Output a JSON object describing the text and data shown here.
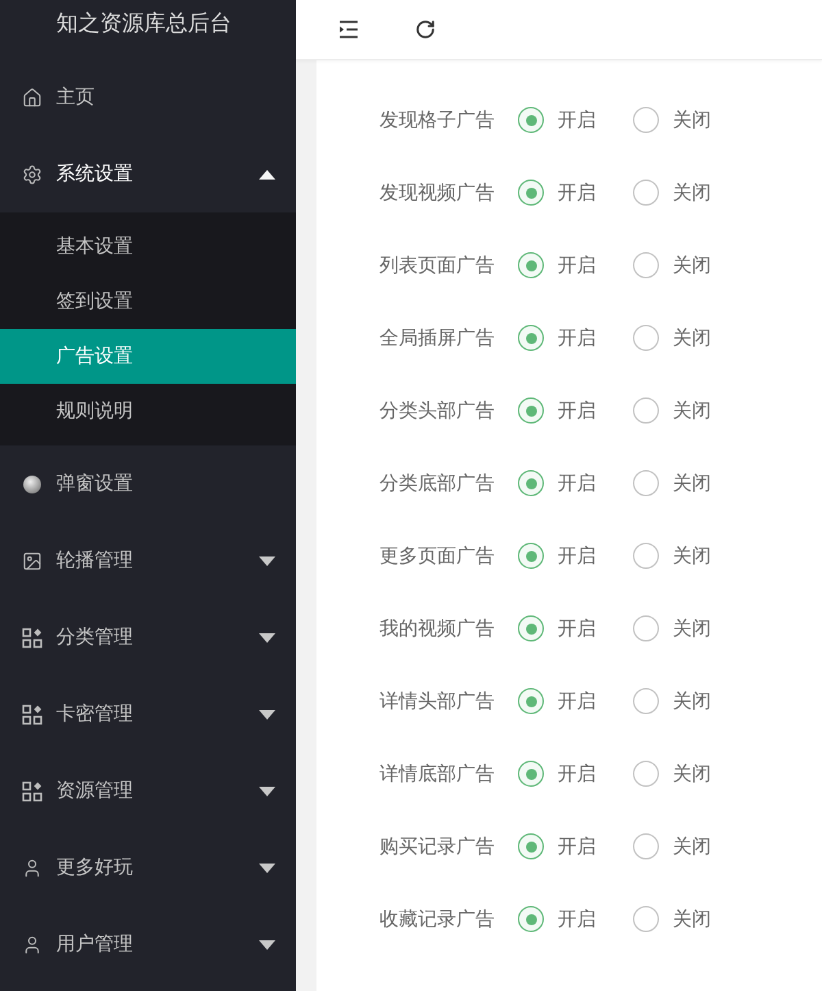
{
  "sidebar": {
    "title": "知之资源库总后台",
    "items": [
      {
        "label": "主页",
        "kind": "link"
      },
      {
        "label": "系统设置",
        "kind": "group",
        "expanded": true,
        "children": [
          {
            "label": "基本设置",
            "selected": false
          },
          {
            "label": "签到设置",
            "selected": false
          },
          {
            "label": "广告设置",
            "selected": true
          },
          {
            "label": "规则说明",
            "selected": false
          }
        ]
      },
      {
        "label": "弹窗设置",
        "kind": "link"
      },
      {
        "label": "轮播管理",
        "kind": "group",
        "expanded": false
      },
      {
        "label": "分类管理",
        "kind": "group",
        "expanded": false
      },
      {
        "label": "卡密管理",
        "kind": "group",
        "expanded": false
      },
      {
        "label": "资源管理",
        "kind": "group",
        "expanded": false
      },
      {
        "label": "更多好玩",
        "kind": "group",
        "expanded": false
      },
      {
        "label": "用户管理",
        "kind": "group",
        "expanded": false
      }
    ]
  },
  "settings": {
    "rows": [
      {
        "label": "发现格子广告",
        "options": [
          {
            "label": "开启",
            "selected": true
          },
          {
            "label": "关闭",
            "selected": false
          }
        ]
      },
      {
        "label": "发现视频广告",
        "options": [
          {
            "label": "开启",
            "selected": true
          },
          {
            "label": "关闭",
            "selected": false
          }
        ]
      },
      {
        "label": "列表页面广告",
        "options": [
          {
            "label": "开启",
            "selected": true
          },
          {
            "label": "关闭",
            "selected": false
          }
        ]
      },
      {
        "label": "全局插屏广告",
        "options": [
          {
            "label": "开启",
            "selected": true
          },
          {
            "label": "关闭",
            "selected": false
          }
        ]
      },
      {
        "label": "分类头部广告",
        "options": [
          {
            "label": "开启",
            "selected": true
          },
          {
            "label": "关闭",
            "selected": false
          }
        ]
      },
      {
        "label": "分类底部广告",
        "options": [
          {
            "label": "开启",
            "selected": true
          },
          {
            "label": "关闭",
            "selected": false
          }
        ]
      },
      {
        "label": "更多页面广告",
        "options": [
          {
            "label": "开启",
            "selected": true
          },
          {
            "label": "关闭",
            "selected": false
          }
        ]
      },
      {
        "label": "我的视频广告",
        "options": [
          {
            "label": "开启",
            "selected": true
          },
          {
            "label": "关闭",
            "selected": false
          }
        ]
      },
      {
        "label": "详情头部广告",
        "options": [
          {
            "label": "开启",
            "selected": true
          },
          {
            "label": "关闭",
            "selected": false
          }
        ]
      },
      {
        "label": "详情底部广告",
        "options": [
          {
            "label": "开启",
            "selected": true
          },
          {
            "label": "关闭",
            "selected": false
          }
        ]
      },
      {
        "label": "购买记录广告",
        "options": [
          {
            "label": "开启",
            "selected": true
          },
          {
            "label": "关闭",
            "selected": false
          }
        ]
      },
      {
        "label": "收藏记录广告",
        "options": [
          {
            "label": "开启",
            "selected": true
          },
          {
            "label": "关闭",
            "selected": false
          }
        ]
      }
    ]
  }
}
